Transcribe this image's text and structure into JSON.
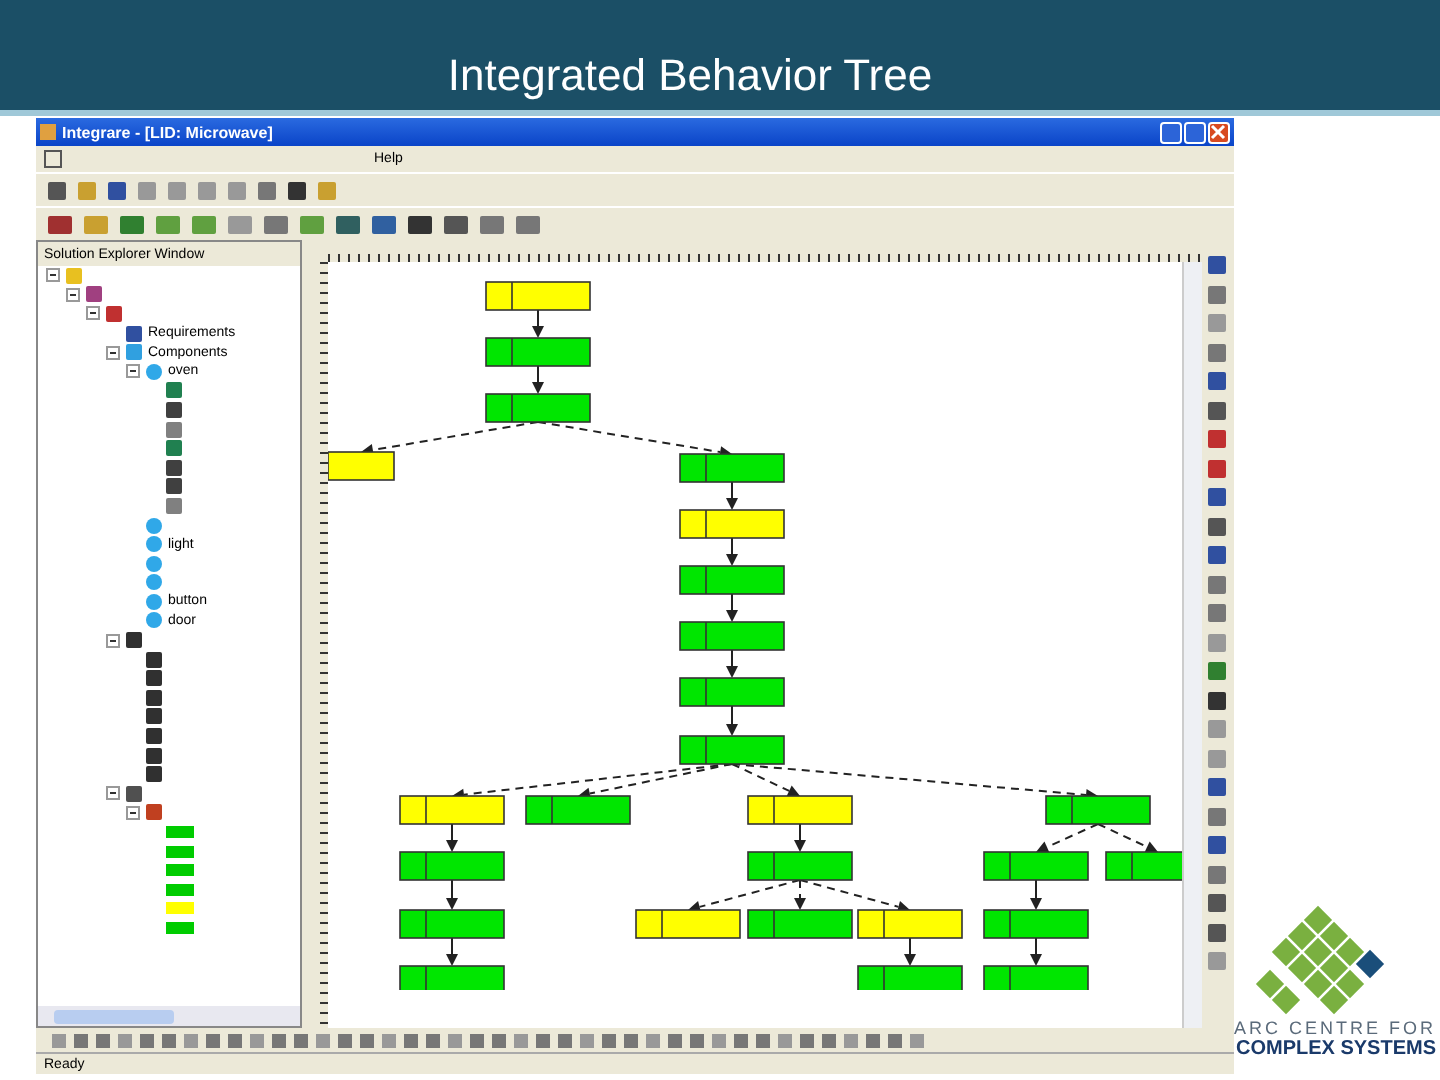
{
  "slide": {
    "title": "Integrated Behavior Tree"
  },
  "window": {
    "title": "Integrare - [LID: Microwave]"
  },
  "menu": [
    "Help"
  ],
  "explorer": {
    "title": "Solution Explorer Window",
    "tree": [
      {
        "kind": "system",
        "expanded": true,
        "children": [
          {
            "kind": "design",
            "expanded": true,
            "children": [
              {
                "kind": "check",
                "expanded": true,
                "children": [
                  {
                    "kind": "requirement",
                    "label": "Requirements"
                  },
                  {
                    "kind": "component",
                    "label": "Components",
                    "expanded": true,
                    "children": [
                      {
                        "kind": "part",
                        "label": "oven",
                        "expanded": true,
                        "children": [
                          {
                            "kind": "state"
                          },
                          {
                            "kind": "event"
                          },
                          {
                            "kind": "guard"
                          },
                          {
                            "kind": "state"
                          },
                          {
                            "kind": "event"
                          },
                          {
                            "kind": "event"
                          },
                          {
                            "kind": "guard"
                          }
                        ]
                      },
                      {
                        "kind": "part"
                      },
                      {
                        "kind": "part",
                        "label": "light"
                      },
                      {
                        "kind": "part"
                      },
                      {
                        "kind": "part"
                      },
                      {
                        "kind": "part",
                        "label": "button"
                      },
                      {
                        "kind": "part",
                        "label": "door"
                      }
                    ]
                  },
                  {
                    "kind": "network",
                    "expanded": true,
                    "children": [
                      {
                        "kind": "requirement-tree"
                      },
                      {
                        "kind": "requirement-tree"
                      },
                      {
                        "kind": "requirement-tree"
                      },
                      {
                        "kind": "requirement-tree"
                      },
                      {
                        "kind": "requirement-tree"
                      },
                      {
                        "kind": "requirement-tree"
                      },
                      {
                        "kind": "requirement-tree"
                      }
                    ]
                  },
                  {
                    "kind": "tests",
                    "expanded": true,
                    "children": [
                      {
                        "kind": "test",
                        "expanded": true,
                        "children": [
                          {
                            "kind": "result",
                            "color": "#00cc00"
                          },
                          {
                            "kind": "result",
                            "color": "#00cc00"
                          },
                          {
                            "kind": "result",
                            "color": "#00cc00"
                          },
                          {
                            "kind": "result",
                            "color": "#00cc00"
                          },
                          {
                            "kind": "result",
                            "color": "#ffff00"
                          },
                          {
                            "kind": "result",
                            "color": "#00cc00"
                          }
                        ]
                      }
                    ]
                  }
                ]
              }
            ]
          }
        ]
      }
    ]
  },
  "diagram": {
    "root": {
      "color": "#ffff00",
      "children": [
        {
          "color": "#00e600",
          "dashed": false,
          "children": [
            {
              "color": "#00e600",
              "dashed": false,
              "children": [
                {
                  "color": "#ffff00",
                  "dashed": true
                },
                {
                  "color": "#00e600",
                  "dashed": true,
                  "children": [
                    {
                      "color": "#ffff00",
                      "dashed": false,
                      "children": [
                        {
                          "color": "#00e600",
                          "dashed": false,
                          "children": [
                            {
                              "color": "#00e600",
                              "dashed": false,
                              "children": [
                                {
                                  "color": "#00e600",
                                  "dashed": false,
                                  "children": [
                                    {
                                      "color": "#00e600",
                                      "dashed": false,
                                      "children": [
                                        {
                                          "color": "#ffff00",
                                          "dashed": true,
                                          "children": [
                                            {
                                              "color": "#00e600",
                                              "dashed": false,
                                              "children": [
                                                {
                                                  "color": "#00e600",
                                                  "dashed": false,
                                                  "children": [
                                                    {
                                                      "color": "#00e600",
                                                      "dashed": false
                                                    }
                                                  ]
                                                }
                                              ]
                                            }
                                          ]
                                        },
                                        {
                                          "color": "#00e600",
                                          "dashed": true
                                        },
                                        {
                                          "color": "#ffff00",
                                          "dashed": true,
                                          "children": [
                                            {
                                              "color": "#00e600",
                                              "dashed": false,
                                              "children": [
                                                {
                                                  "color": "#ffff00",
                                                  "dashed": true
                                                },
                                                {
                                                  "color": "#00e600",
                                                  "dashed": true
                                                },
                                                {
                                                  "color": "#ffff00",
                                                  "dashed": true,
                                                  "children": [
                                                    {
                                                      "color": "#00e600",
                                                      "dashed": false
                                                    }
                                                  ]
                                                }
                                              ]
                                            }
                                          ]
                                        },
                                        {
                                          "color": "#00e600",
                                          "dashed": true,
                                          "children": [
                                            {
                                              "color": "#00e600",
                                              "dashed": true,
                                              "children": [
                                                {
                                                  "color": "#00e600",
                                                  "dashed": false,
                                                  "children": [
                                                    {
                                                      "color": "#00e600",
                                                      "dashed": false
                                                    }
                                                  ]
                                                }
                                              ]
                                            },
                                            {
                                              "color": "#00e600",
                                              "dashed": true
                                            }
                                          ]
                                        }
                                      ]
                                    }
                                  ]
                                }
                              ]
                            }
                          ]
                        }
                      ]
                    }
                  ]
                }
              ]
            }
          ]
        }
      ]
    }
  },
  "status_bar": {
    "text": "Ready"
  },
  "logo": {
    "line1": "ARC CENTRE FOR",
    "line2": "COMPLEX SYSTEMS"
  }
}
